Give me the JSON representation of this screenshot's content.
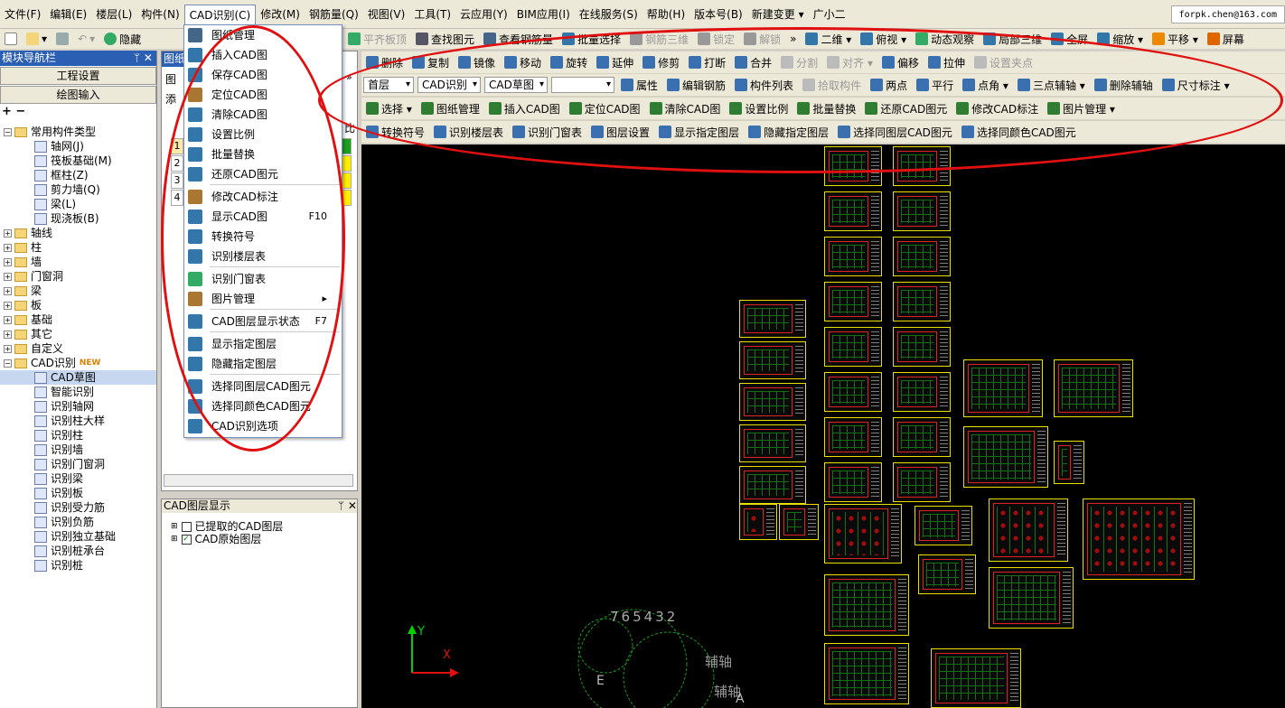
{
  "menubar": {
    "items": [
      "文件(F)",
      "编辑(E)",
      "楼层(L)",
      "构件(N)",
      "CAD识别(C)",
      "修改(M)",
      "钢筋量(Q)",
      "视图(V)",
      "工具(T)",
      "云应用(Y)",
      "BIM应用(I)",
      "在线服务(S)",
      "帮助(H)",
      "版本号(B)",
      "新建变更 ▾",
      "广小二"
    ],
    "email": "forpk.chen@163.com"
  },
  "toolbar1": {
    "left": [
      "▾",
      "▾",
      "隐藏"
    ],
    "right": [
      "平齐板顶",
      "查找图元",
      "查看钢筋量",
      "批量选择",
      "钢筋三维",
      "锁定",
      "解锁",
      "»",
      "二维 ▾",
      "俯视 ▾",
      "动态观察",
      "局部三维",
      "全屏",
      "缩放 ▾",
      "平移 ▾",
      "屏幕"
    ]
  },
  "leftnav": {
    "title": "模块导航栏",
    "pin": "ᛘ ✕",
    "buttons": [
      "工程设置",
      "绘图输入"
    ],
    "tree": [
      {
        "label": "常用构件类型",
        "type": "folder",
        "expanded": true,
        "level": 0
      },
      {
        "label": "轴网(J)",
        "type": "leaf",
        "level": 1
      },
      {
        "label": "筏板基础(M)",
        "type": "leaf",
        "level": 1
      },
      {
        "label": "框柱(Z)",
        "type": "leaf",
        "level": 1
      },
      {
        "label": "剪力墙(Q)",
        "type": "leaf",
        "level": 1
      },
      {
        "label": "梁(L)",
        "type": "leaf",
        "level": 1
      },
      {
        "label": "现浇板(B)",
        "type": "leaf",
        "level": 1
      },
      {
        "label": "轴线",
        "type": "folder",
        "level": 0
      },
      {
        "label": "柱",
        "type": "folder",
        "level": 0
      },
      {
        "label": "墙",
        "type": "folder",
        "level": 0
      },
      {
        "label": "门窗洞",
        "type": "folder",
        "level": 0
      },
      {
        "label": "梁",
        "type": "folder",
        "level": 0
      },
      {
        "label": "板",
        "type": "folder",
        "level": 0
      },
      {
        "label": "基础",
        "type": "folder",
        "level": 0
      },
      {
        "label": "其它",
        "type": "folder",
        "level": 0
      },
      {
        "label": "自定义",
        "type": "folder",
        "level": 0
      },
      {
        "label": "CAD识别",
        "type": "folder",
        "expanded": true,
        "level": 0,
        "badge": "NEW"
      },
      {
        "label": "CAD草图",
        "type": "leaf",
        "level": 1,
        "selected": true
      },
      {
        "label": "智能识别",
        "type": "leaf",
        "level": 1
      },
      {
        "label": "识别轴网",
        "type": "leaf",
        "level": 1
      },
      {
        "label": "识别柱大样",
        "type": "leaf",
        "level": 1
      },
      {
        "label": "识别柱",
        "type": "leaf",
        "level": 1
      },
      {
        "label": "识别墙",
        "type": "leaf",
        "level": 1
      },
      {
        "label": "识别门窗洞",
        "type": "leaf",
        "level": 1
      },
      {
        "label": "识别梁",
        "type": "leaf",
        "level": 1
      },
      {
        "label": "识别板",
        "type": "leaf",
        "level": 1
      },
      {
        "label": "识别受力筋",
        "type": "leaf",
        "level": 1
      },
      {
        "label": "识别负筋",
        "type": "leaf",
        "level": 1
      },
      {
        "label": "识别独立基础",
        "type": "leaf",
        "level": 1
      },
      {
        "label": "识别桩承台",
        "type": "leaf",
        "level": 1
      },
      {
        "label": "识别桩",
        "type": "leaf",
        "level": 1
      }
    ]
  },
  "midpanel": {
    "title": "图纸",
    "tab1": "图",
    "tab2": "添",
    "rows": [
      "1",
      "2",
      "3",
      "4"
    ],
    "collapse": "»",
    "cut_label": "比"
  },
  "layerpanel": {
    "title": "CAD图层显示",
    "pin": "ᛘ ✕",
    "rows": [
      {
        "label": "已提取的CAD图层",
        "checked": false
      },
      {
        "label": "CAD原始图层",
        "checked": true
      }
    ]
  },
  "dropdown": {
    "items": [
      {
        "label": "图纸管理",
        "shortcut": ""
      },
      {
        "label": "插入CAD图",
        "shortcut": ""
      },
      {
        "label": "保存CAD图",
        "shortcut": ""
      },
      {
        "label": "定位CAD图",
        "shortcut": ""
      },
      {
        "label": "清除CAD图",
        "shortcut": ""
      },
      {
        "label": "设置比例",
        "shortcut": ""
      },
      {
        "label": "批量替换",
        "shortcut": ""
      },
      {
        "label": "还原CAD图元",
        "shortcut": ""
      },
      {
        "label": "修改CAD标注",
        "shortcut": ""
      },
      {
        "label": "显示CAD图",
        "shortcut": "F10"
      },
      {
        "label": "转换符号",
        "shortcut": ""
      },
      {
        "label": "识别楼层表",
        "shortcut": ""
      },
      {
        "label": "识别门窗表",
        "shortcut": ""
      },
      {
        "label": "图片管理",
        "shortcut": "▸"
      },
      {
        "label": "CAD图层显示状态",
        "shortcut": "F7"
      },
      {
        "label": "显示指定图层",
        "shortcut": ""
      },
      {
        "label": "隐藏指定图层",
        "shortcut": ""
      },
      {
        "label": "选择同图层CAD图元",
        "shortcut": ""
      },
      {
        "label": "选择同颜色CAD图元",
        "shortcut": ""
      },
      {
        "label": "CAD识别选项",
        "shortcut": ""
      }
    ]
  },
  "edit_toolbar": [
    "删除",
    "复制",
    "镜像",
    "移动",
    "旋转",
    "延伸",
    "修剪",
    "打断",
    "合并",
    "分割",
    "对齐 ▾",
    "偏移",
    "拉伸",
    "设置夹点"
  ],
  "floor_toolbar": {
    "floor": "首层",
    "mode": "CAD识别",
    "sketch": "CAD草图",
    "blank": "",
    "buttons": [
      "属性",
      "编辑钢筋",
      "构件列表",
      "拾取构件",
      "两点",
      "平行",
      "点角 ▾",
      "三点辅轴 ▾",
      "删除辅轴",
      "尺寸标注 ▾"
    ]
  },
  "cad_toolbar": [
    "选择 ▾",
    "图纸管理",
    "插入CAD图",
    "定位CAD图",
    "清除CAD图",
    "设置比例",
    "批量替换",
    "还原CAD图元",
    "修改CAD标注",
    "图片管理 ▾"
  ],
  "cad_toolbar2": [
    "转换符号",
    "识别楼层表",
    "识别门窗表",
    "图层设置",
    "显示指定图层",
    "隐藏指定图层",
    "选择同图层CAD图元",
    "选择同颜色CAD图元"
  ],
  "canvas": {
    "axis_y": "Y",
    "axis_x": "X",
    "overlay_text": [
      "7",
      "6",
      "5",
      "4",
      "3",
      "2",
      "辅轴",
      "辅轴",
      "E",
      "A"
    ]
  },
  "colors": {
    "canvas_bg": "#000000",
    "annotation": "#e01010",
    "sheet_border": "#e8e000",
    "panel_title": "#2b5fb3"
  }
}
